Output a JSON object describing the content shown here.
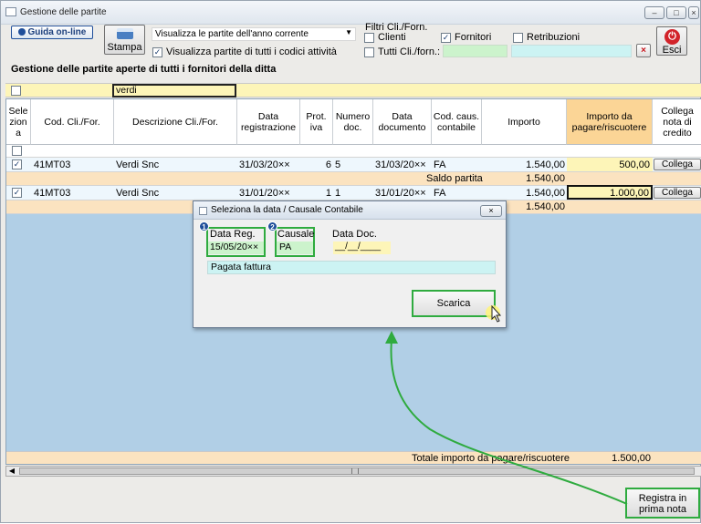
{
  "window": {
    "title": "Gestione delle partite"
  },
  "toolbar": {
    "guida_label": "Guida on-line",
    "stampa_label": "Stampa",
    "view_select": "Visualizza le partite dell'anno corrente",
    "all_codes_label": "Visualizza partite di tutti i codici attività",
    "section_title": "Gestione delle partite aperte di tutti i fornitori della ditta",
    "esci_label": "Esci"
  },
  "filters": {
    "title": "Filtri Cli./Forn.",
    "clienti": "Clienti",
    "fornitori": "Fornitori",
    "retribuzioni": "Retribuzioni",
    "tutti": "Tutti Cli./forn.:"
  },
  "filter_row": {
    "descrizione": "verdi"
  },
  "columns": {
    "seleziona": "Sele zion a",
    "cod": "Cod. Cli./For.",
    "descrizione": "Descrizione Cli./For.",
    "data_reg": "Data registrazione",
    "prot": "Prot. iva",
    "numero": "Numero doc.",
    "data_doc": "Data documento",
    "causale": "Cod. caus. contabile",
    "importo": "Importo",
    "importo_pagare": "Importo da pagare/riscuotere",
    "collega": "Collega nota di credito"
  },
  "rows": [
    {
      "cod": "41MT03",
      "descrizione": "Verdi Snc",
      "data_reg": "31/03/20××",
      "prot": "6",
      "numero": "5",
      "data_doc": "31/03/20××",
      "causale": "FA",
      "importo": "1.540,00",
      "importo_pagare": "500,00",
      "collega": "Collega"
    },
    {
      "cod": "41MT03",
      "descrizione": "Verdi Snc",
      "data_reg": "31/01/20××",
      "prot": "1",
      "numero": "1",
      "data_doc": "31/01/20××",
      "causale": "FA",
      "importo": "1.540,00",
      "importo_pagare": "1.000,00",
      "collega": "Collega"
    }
  ],
  "saldo": {
    "label": "Saldo partita",
    "value1": "1.540,00",
    "value2": "1.540,00"
  },
  "totale": {
    "label": "Totale importo da pagare/riscuotere",
    "value": "1.500,00"
  },
  "dialog": {
    "title": "Seleziona la data / Causale Contabile",
    "data_reg_label": "Data Reg.",
    "data_reg_value": "15/05/20××",
    "causale_label": "Causale",
    "causale_value": "PA",
    "data_doc_label": "Data Doc.",
    "data_doc_value": "__/__/____",
    "note_value": "Pagata fattura",
    "scarica_label": "Scarica",
    "badge1": "1",
    "badge2": "2"
  },
  "registra": {
    "label": "Registra in prima nota"
  },
  "colors": {
    "accent_green": "#2fab3f",
    "highlight_yellow": "#fdf5b8",
    "grid_blue": "#b1cfe6"
  }
}
